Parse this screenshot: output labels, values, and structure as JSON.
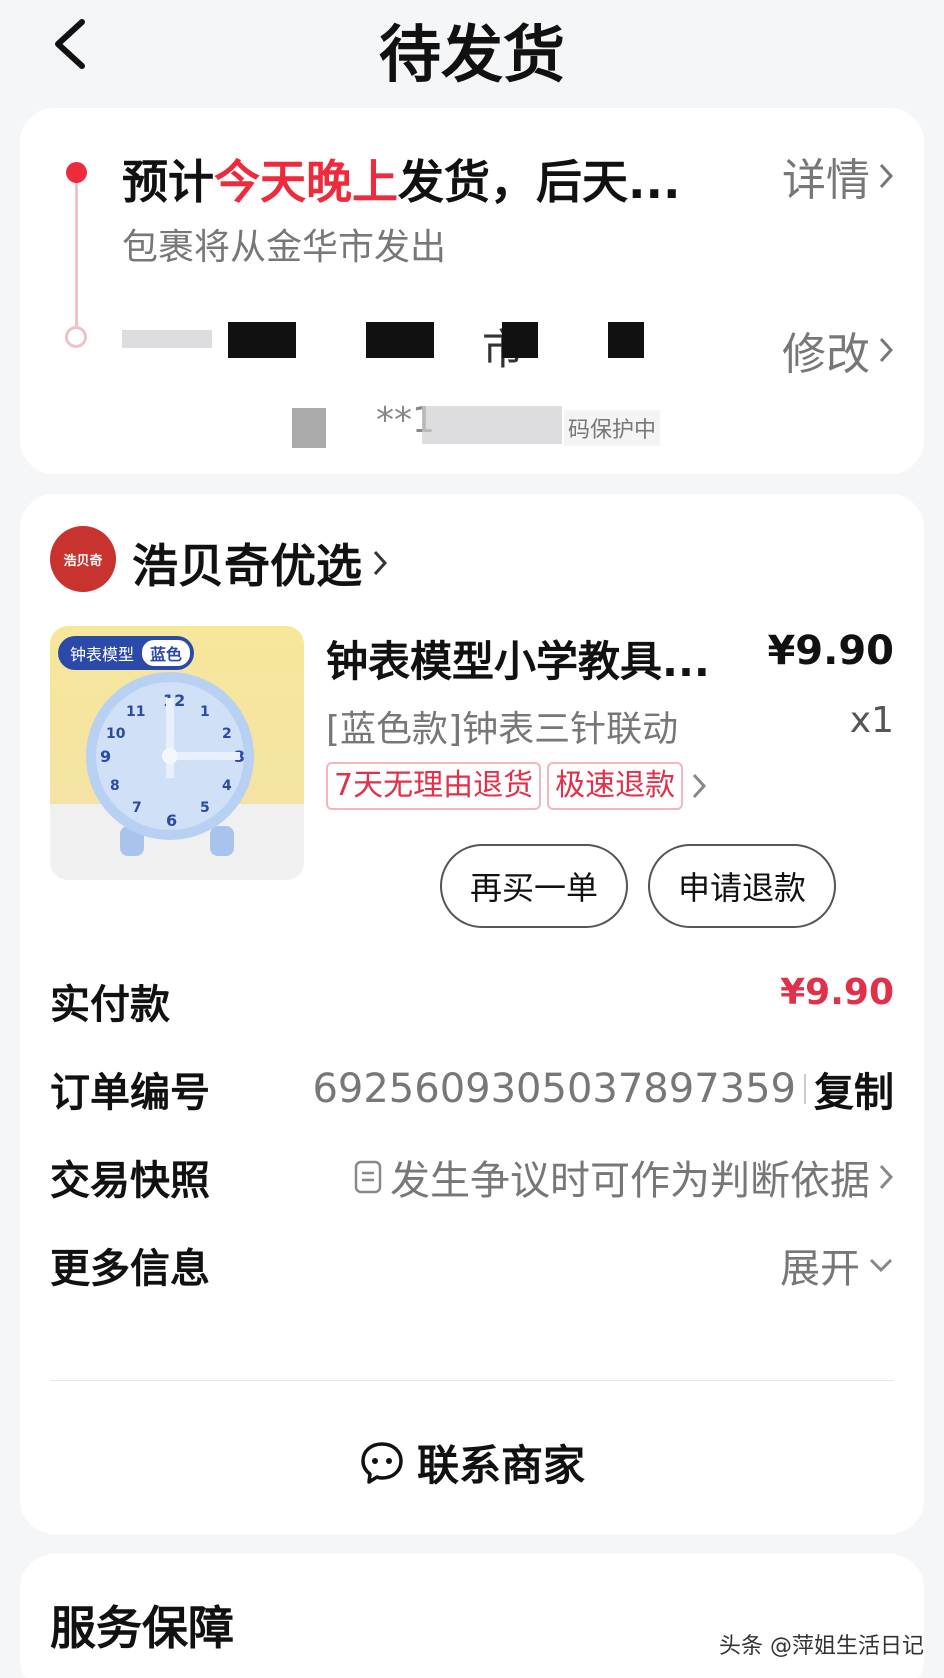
{
  "header": {
    "title": "待发货"
  },
  "shipping": {
    "estimate_prefix": "预计",
    "estimate_highlight": "今天晚上",
    "estimate_suffix": "发货，后天...",
    "detail_label": "详情",
    "origin": "包裹将从金华市发出",
    "address_visible": "市",
    "modify_label": "修改",
    "phone_masked": "**1",
    "privacy": "码保护中"
  },
  "shop": {
    "logo_text": "浩贝奇",
    "name": "浩贝奇优选"
  },
  "product": {
    "image_tag": "钟表模型",
    "image_tag_color": "蓝色",
    "title": "钟表模型小学教具...",
    "price": "¥9.90",
    "spec": "[蓝色款]钟表三针联动",
    "qty": "x1",
    "tags": [
      "7天无理由退货",
      "极速退款"
    ]
  },
  "actions": {
    "rebuy": "再买一单",
    "refund": "申请退款"
  },
  "info": {
    "paid_label": "实付款",
    "paid_value": "¥9.90",
    "order_label": "订单编号",
    "order_value": "6925609305037897359",
    "copy_label": "复制",
    "snapshot_label": "交易快照",
    "snapshot_value": "发生争议时可作为判断依据",
    "more_label": "更多信息",
    "more_value": "展开"
  },
  "contact": {
    "label": "联系商家"
  },
  "service": {
    "title": "服务保障"
  },
  "watermark": "头条 @萍姐生活日记",
  "colors": {
    "accent": "#ee2b3c"
  }
}
